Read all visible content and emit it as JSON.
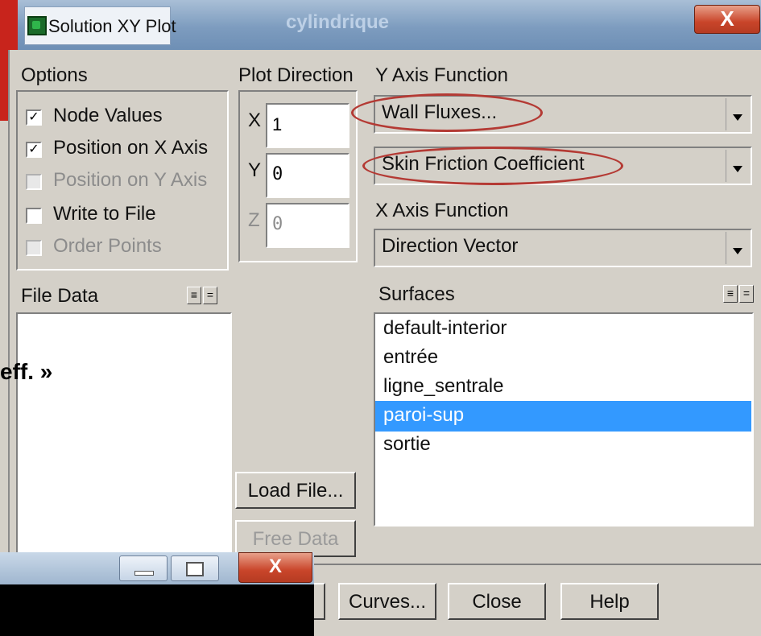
{
  "window": {
    "title": "Solution XY Plot",
    "background_title": "cylindrique",
    "close_label": "X"
  },
  "options": {
    "heading": "Options",
    "items": [
      {
        "label": "Node Values",
        "checked": true,
        "enabled": true
      },
      {
        "label": "Position on X Axis",
        "checked": true,
        "enabled": true
      },
      {
        "label": "Position on Y Axis",
        "checked": false,
        "enabled": false
      },
      {
        "label": "Write to File",
        "checked": false,
        "enabled": true
      },
      {
        "label": "Order Points",
        "checked": false,
        "enabled": false
      }
    ]
  },
  "plot_direction": {
    "heading": "Plot Direction",
    "x_label": "X",
    "x_value": "1",
    "y_label": "Y",
    "y_value": "0",
    "z_label": "Z",
    "z_value": "0"
  },
  "y_axis": {
    "heading": "Y Axis Function",
    "category": "Wall Fluxes...",
    "function": "Skin Friction Coefficient"
  },
  "x_axis": {
    "heading": "X Axis Function",
    "function": "Direction Vector"
  },
  "file_data": {
    "heading": "File Data"
  },
  "surfaces": {
    "heading": "Surfaces",
    "items": [
      "default-interior",
      "entrée",
      "ligne_sentrale",
      "paroi-sup",
      "sortie"
    ],
    "selected": "paroi-sup"
  },
  "buttons": {
    "load_file": "Load File...",
    "free_data": "Free Data",
    "curves": "Curves...",
    "close": "Close",
    "help": "Help"
  },
  "background_text": "eff. »",
  "overlay": {
    "close_label": "X"
  },
  "colors": {
    "selection": "#3399ff",
    "annotation_oval": "#b43a34"
  }
}
